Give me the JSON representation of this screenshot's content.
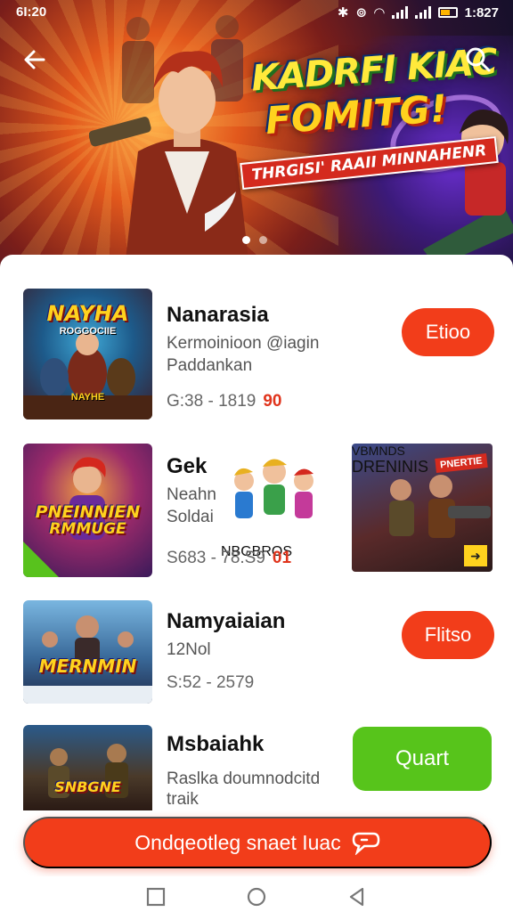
{
  "status_bar": {
    "time": "6I:20",
    "right_time": "1:827"
  },
  "hero": {
    "title_line1": "KADRFI KIAC",
    "title_line2": "FOMITG!",
    "tagline": "THRGISI' RAAII MINNAHENR",
    "slide_count": 2,
    "active_slide": 0
  },
  "games": [
    {
      "thumb_title": "NAYHA",
      "thumb_subtitle": "ROGGOCIIE",
      "thumb_footer": "NAYHE",
      "title": "Nanarasia",
      "desc_line1": "Kermoinioon @iagin",
      "desc_line2": "Paddankan",
      "meta": "G:38 - 1819",
      "meta_highlight": "90",
      "action": "Etioo"
    },
    {
      "thumb_title": "PNEINNIEN",
      "thumb_subtitle": "RMMUGE",
      "title": "Gek",
      "desc_line1": "Neahn",
      "desc_line2": "Soldai",
      "mid_art_label": "NBGBROS",
      "meta": "S683 - 78.S9",
      "meta_highlight": "01",
      "side_art_top": "VBMNDS",
      "side_art_badge": "PNERTIE",
      "side_art_label": "DRENINIS"
    },
    {
      "thumb_title": "MERNMIN",
      "title": "Namyaiaian",
      "desc_line1": "12Nol",
      "meta": "S:52 - 2579",
      "action": "Flitso"
    },
    {
      "thumb_title": "SNBGNE",
      "title": "Msbaiahk",
      "desc_line1": "Raslka doumnodcitd",
      "desc_line2": "traik",
      "action": "Quart"
    }
  ],
  "cta": {
    "label": "Ondqeotleg snaet Iuac"
  },
  "colors": {
    "accent": "#f23d1a",
    "green": "#57c41b"
  }
}
